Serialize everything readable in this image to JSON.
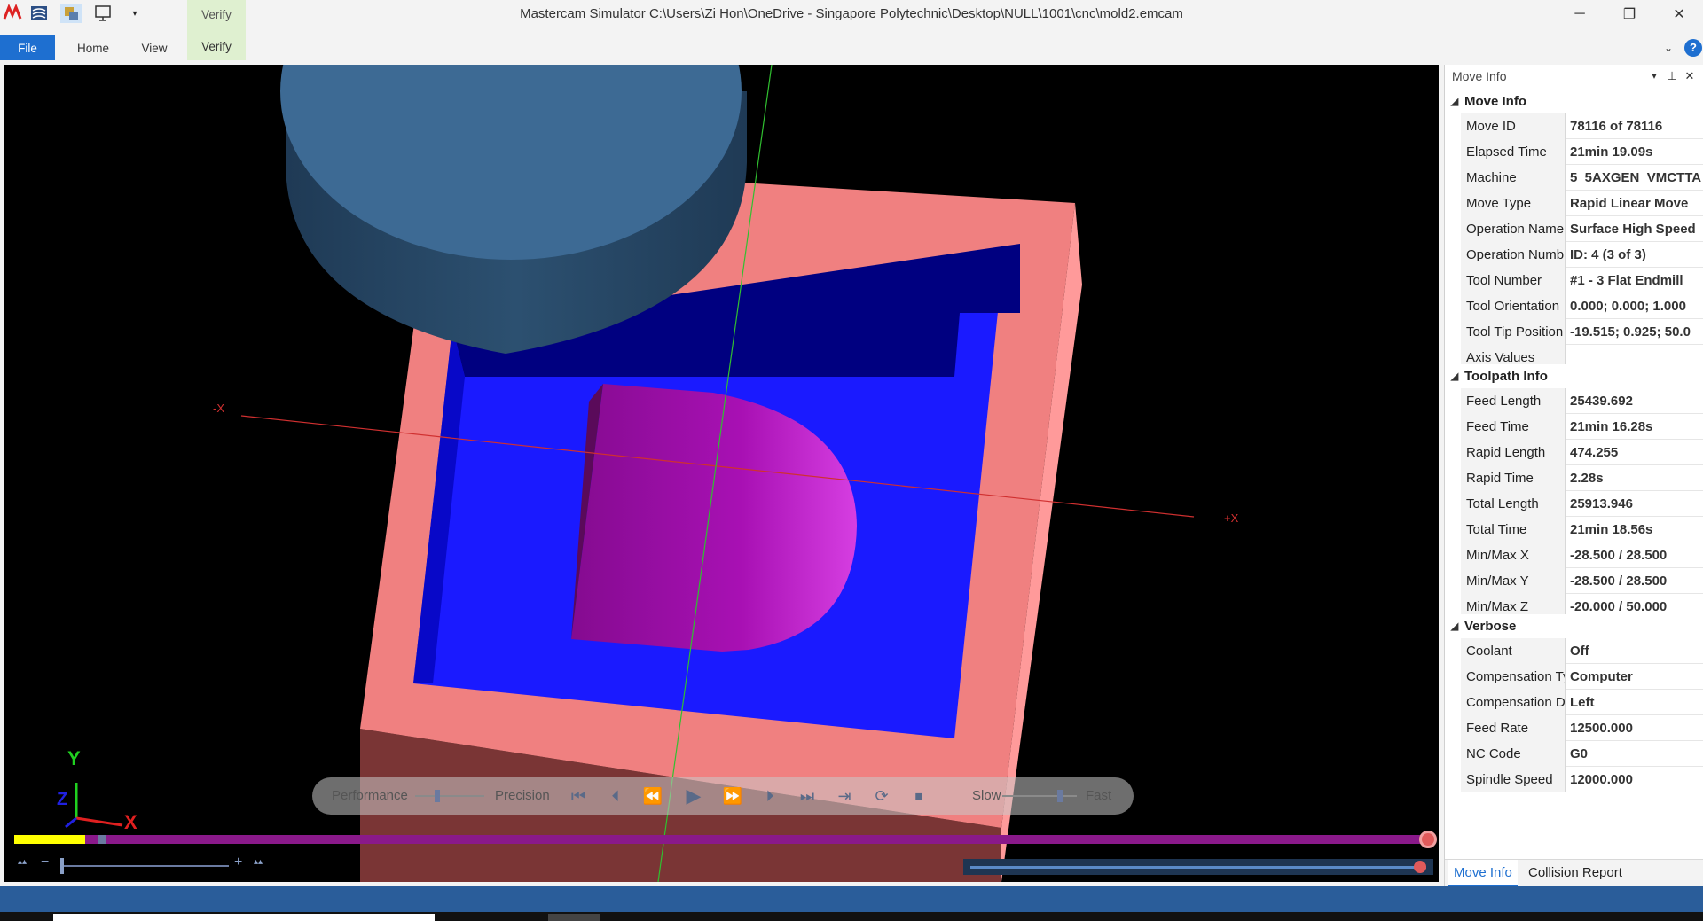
{
  "window": {
    "title": "Mastercam Simulator  C:\\Users\\Zi Hon\\OneDrive - Singapore Polytechnic\\Desktop\\NULL\\1001\\cnc\\mold2.emcam",
    "minimize": "─",
    "restore": "❐",
    "close": "✕"
  },
  "ribbon": {
    "file": "File",
    "home": "Home",
    "view": "View",
    "context_label": "Verify",
    "verify": "Verify",
    "collapse_icon": "chevron-down-icon",
    "help": "?"
  },
  "viewport": {
    "axis_neg_x": "-X",
    "axis_pos_x": "+X",
    "triad_x": "X",
    "triad_y": "Y",
    "triad_z": "Z",
    "colors": {
      "stock": "#f08080",
      "pocket": "#1a1aff",
      "part": "#b000b0",
      "tool": "#3d6a94",
      "progress_fill": "#ffff00",
      "progress_track": "#8a198a"
    },
    "progress": 0.05
  },
  "controls": {
    "performance": "Performance",
    "precision": "Precision",
    "slow": "Slow",
    "fast": "Fast",
    "zoom_minus": "−",
    "zoom_plus": "+",
    "performance_level": 0.3,
    "speed_level": 0.8
  },
  "panel": {
    "title": "Move Info",
    "sections": {
      "move_info": "Move Info",
      "toolpath_info": "Toolpath Info",
      "verbose": "Verbose"
    },
    "move_info": [
      {
        "k": "Move ID",
        "v": "78116 of 78116"
      },
      {
        "k": "Elapsed Time",
        "v": "21min 19.09s"
      },
      {
        "k": "Machine",
        "v": "5_5AXGEN_VMCTTA"
      },
      {
        "k": "Move Type",
        "v": "Rapid Linear Move"
      },
      {
        "k": "Operation Name",
        "v": "Surface High Speed"
      },
      {
        "k": "Operation Numb",
        "v": "ID: 4 (3 of 3)"
      },
      {
        "k": "Tool Number",
        "v": "#1 - 3 Flat Endmill"
      },
      {
        "k": "Tool Orientation",
        "v": "0.000; 0.000; 1.000"
      },
      {
        "k": "Tool Tip Position",
        "v": "-19.515; 0.925; 50.0"
      },
      {
        "k": "Axis Values",
        "v": ""
      }
    ],
    "toolpath_info": [
      {
        "k": "Feed Length",
        "v": "25439.692"
      },
      {
        "k": "Feed Time",
        "v": "21min 16.28s"
      },
      {
        "k": "Rapid Length",
        "v": "474.255"
      },
      {
        "k": "Rapid Time",
        "v": "2.28s"
      },
      {
        "k": "Total Length",
        "v": "25913.946"
      },
      {
        "k": "Total Time",
        "v": "21min 18.56s"
      },
      {
        "k": "Min/Max X",
        "v": "-28.500 / 28.500"
      },
      {
        "k": "Min/Max Y",
        "v": "-28.500 / 28.500"
      },
      {
        "k": "Min/Max Z",
        "v": "-20.000 / 50.000"
      }
    ],
    "verbose": [
      {
        "k": "Coolant",
        "v": "Off"
      },
      {
        "k": "Compensation Ty",
        "v": "Computer"
      },
      {
        "k": "Compensation D",
        "v": "Left"
      },
      {
        "k": "Feed Rate",
        "v": "12500.000"
      },
      {
        "k": "NC Code",
        "v": "G0"
      },
      {
        "k": "Spindle Speed",
        "v": "12000.000"
      }
    ],
    "tabs": [
      "Move Info",
      "Collision Report"
    ]
  }
}
